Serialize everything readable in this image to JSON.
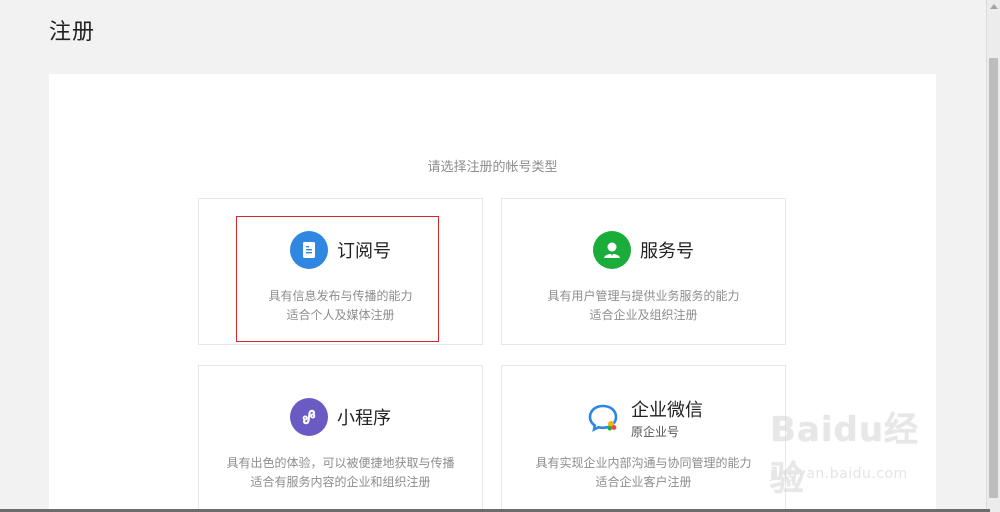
{
  "page": {
    "title": "注册"
  },
  "panel": {
    "subtitle": "请选择注册的帐号类型"
  },
  "cards": [
    {
      "name": "订阅号",
      "subname": "",
      "desc_line1": "具有信息发布与传播的能力",
      "desc_line2": "适合个人及媒体注册",
      "icon": "document-icon",
      "color": "#2f87e2"
    },
    {
      "name": "服务号",
      "subname": "",
      "desc_line1": "具有用户管理与提供业务服务的能力",
      "desc_line2": "适合企业及组织注册",
      "icon": "user-icon",
      "color": "#1aad3a"
    },
    {
      "name": "小程序",
      "subname": "",
      "desc_line1": "具有出色的体验，可以被便捷地获取与传播",
      "desc_line2": "适合有服务内容的企业和组织注册",
      "icon": "miniprogram-icon",
      "color": "#6a5ac4"
    },
    {
      "name": "企业微信",
      "subname": "原企业号",
      "desc_line1": "具有实现企业内部沟通与协同管理的能力",
      "desc_line2": "适合企业客户注册",
      "icon": "wecom-icon",
      "color": "#2b86e4"
    }
  ],
  "watermark": {
    "logo": "Baidu经验",
    "url": "jingyan.baidu.com"
  }
}
